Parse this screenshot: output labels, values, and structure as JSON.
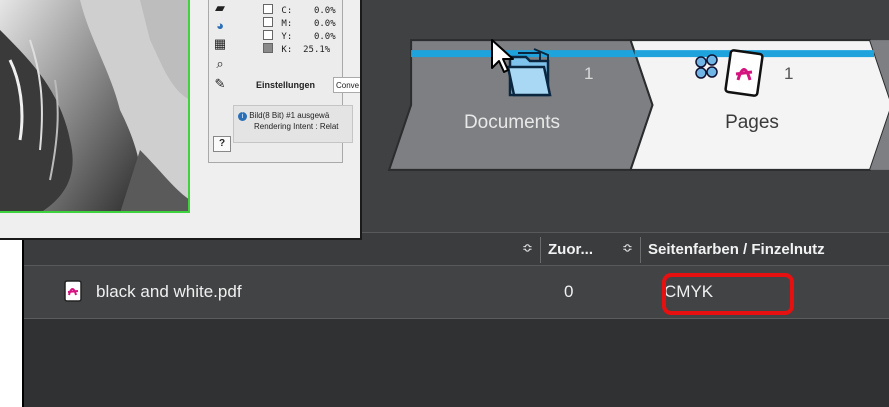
{
  "workflow": {
    "steps": [
      {
        "label": "Documents",
        "count": "1"
      },
      {
        "label": "Pages",
        "count": "1"
      }
    ]
  },
  "table": {
    "columns": [
      "",
      "Zuor...",
      "Seitenfarben / Finzelnutz"
    ],
    "rows": [
      {
        "name": "black and white.pdf",
        "assigned": "0",
        "colors": "CMYK"
      }
    ]
  },
  "palette": {
    "cmyk": [
      {
        "label": "C:",
        "value": "0.0%"
      },
      {
        "label": "M:",
        "value": "0.0%"
      },
      {
        "label": "Y:",
        "value": "0.0%"
      },
      {
        "label": "K:",
        "value": "25.1%"
      }
    ],
    "settings_label": "Einstellungen",
    "settings_value": "Conve",
    "info_line1": "Bild(8 Bit) #1 ausgewä",
    "info_line2": "Rendering Intent : Relat",
    "help": "?"
  },
  "colors": {
    "accent_stripe": "#1ea3dc",
    "highlight": "#e61010",
    "image_border": "#3ed33e"
  }
}
